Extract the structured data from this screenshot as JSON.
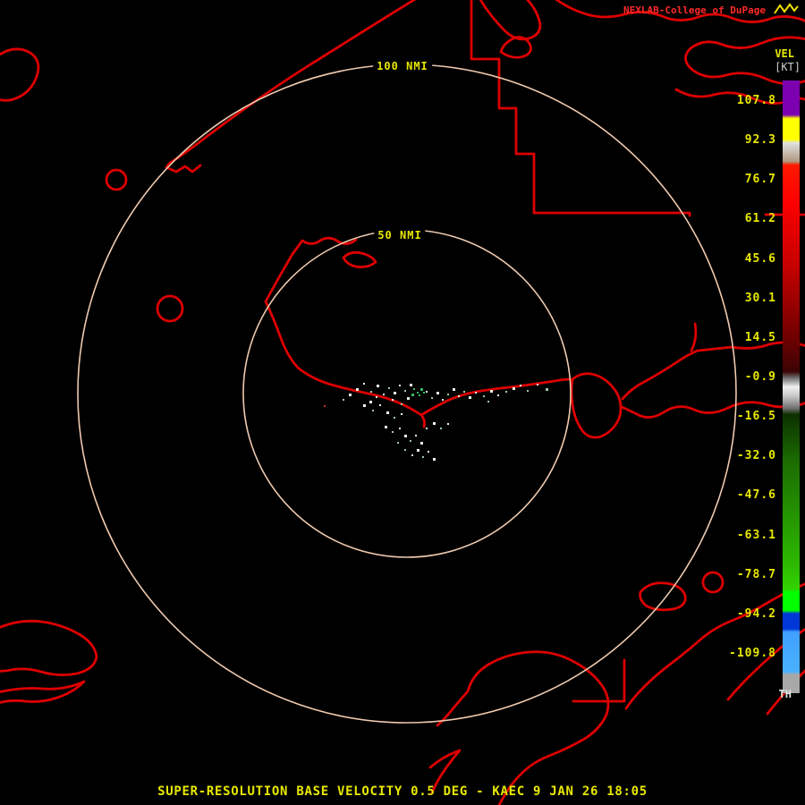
{
  "header": {
    "title": "NEXLAB-College of DuPage",
    "title_color": "#ff2a2a",
    "logo_color": "#f0e000"
  },
  "footer": {
    "caption": "SUPER-RESOLUTION BASE VELOCITY 0.5 DEG - KAEC 9 JAN 26 18:05",
    "caption_color": "#e8e800"
  },
  "map": {
    "background": "#000000",
    "boundary_color": "#dd0000",
    "ring_color": "#eec9ae",
    "label_color": "#e8e800",
    "rings": [
      {
        "label": "100 NMI"
      },
      {
        "label": "50 NMI"
      }
    ],
    "echoes": {
      "colors": {
        "w": "#e8f8e8",
        "p": "#9fc9a8",
        "g": "#2fbf5f",
        "r": "#c03030"
      },
      "dots": [
        [
          398,
          434,
          "w"
        ],
        [
          406,
          428,
          "w"
        ],
        [
          414,
          437,
          "p"
        ],
        [
          421,
          430,
          "w"
        ],
        [
          428,
          440,
          "w"
        ],
        [
          434,
          433,
          "p"
        ],
        [
          440,
          438,
          "w"
        ],
        [
          446,
          430,
          "w"
        ],
        [
          452,
          436,
          "p"
        ],
        [
          458,
          429,
          "w"
        ],
        [
          438,
          446,
          "w"
        ],
        [
          448,
          451,
          "p"
        ],
        [
          455,
          444,
          "w"
        ],
        [
          476,
          437,
          "w"
        ],
        [
          482,
          444,
          "p"
        ],
        [
          488,
          438,
          "w"
        ],
        [
          494,
          446,
          "w"
        ],
        [
          500,
          440,
          "p"
        ],
        [
          506,
          434,
          "w"
        ],
        [
          512,
          442,
          "w"
        ],
        [
          518,
          437,
          "p"
        ],
        [
          524,
          443,
          "w"
        ],
        [
          531,
          438,
          "w"
        ],
        [
          540,
          442,
          "p"
        ],
        [
          548,
          436,
          "w"
        ],
        [
          556,
          441,
          "w"
        ],
        [
          565,
          437,
          "p"
        ],
        [
          573,
          433,
          "w"
        ],
        [
          581,
          430,
          "w"
        ],
        [
          589,
          436,
          "p"
        ],
        [
          406,
          452,
          "w"
        ],
        [
          416,
          458,
          "p"
        ],
        [
          424,
          452,
          "w"
        ],
        [
          432,
          460,
          "w"
        ],
        [
          440,
          466,
          "p"
        ],
        [
          448,
          462,
          "w"
        ],
        [
          430,
          476,
          "w"
        ],
        [
          438,
          482,
          "p"
        ],
        [
          446,
          478,
          "w"
        ],
        [
          452,
          486,
          "w"
        ],
        [
          458,
          492,
          "p"
        ],
        [
          464,
          486,
          "w"
        ],
        [
          470,
          494,
          "w"
        ],
        [
          452,
          502,
          "p"
        ],
        [
          460,
          508,
          "w"
        ],
        [
          466,
          502,
          "w"
        ],
        [
          472,
          510,
          "p"
        ],
        [
          478,
          504,
          "w"
        ],
        [
          484,
          512,
          "w"
        ],
        [
          444,
          494,
          "p"
        ],
        [
          476,
          478,
          "w"
        ],
        [
          484,
          472,
          "w"
        ],
        [
          492,
          478,
          "p"
        ],
        [
          500,
          473,
          "w"
        ],
        [
          390,
          440,
          "w"
        ],
        [
          383,
          446,
          "p"
        ],
        [
          420,
          443,
          "w"
        ],
        [
          413,
          448,
          "w"
        ],
        [
          545,
          448,
          "p"
        ],
        [
          600,
          429,
          "w"
        ],
        [
          610,
          434,
          "p"
        ],
        [
          462,
          434,
          "g"
        ],
        [
          466,
          438,
          "g"
        ],
        [
          470,
          434,
          "g"
        ],
        [
          468,
          441,
          "g"
        ],
        [
          473,
          438,
          "g"
        ],
        [
          460,
          440,
          "g"
        ],
        [
          362,
          453,
          "r"
        ]
      ]
    }
  },
  "colorbar": {
    "unit_line1": "VEL",
    "unit_line2": "[KT]",
    "unit1_color": "#e8e800",
    "unit2_color": "#d0d0d0",
    "bottom_label": "TH",
    "bottom_label_color": "#e0e0e0",
    "tick_color": "#e8e800",
    "ticks": [
      "107.8",
      "92.3",
      "76.7",
      "61.2",
      "45.6",
      "30.1",
      "14.5",
      "-0.9",
      "-16.5",
      "-32.0",
      "-47.6",
      "-63.1",
      "-78.7",
      "-94.2",
      "-109.8"
    ],
    "gradient": [
      {
        "pos": 0,
        "color": "#7d00b0"
      },
      {
        "pos": 5.6,
        "color": "#7d00b0"
      },
      {
        "pos": 6.2,
        "color": "#ffff00"
      },
      {
        "pos": 9.6,
        "color": "#ffff00"
      },
      {
        "pos": 10.2,
        "color": "#e0e0e0"
      },
      {
        "pos": 13.2,
        "color": "#b09880"
      },
      {
        "pos": 13.8,
        "color": "#ff1800"
      },
      {
        "pos": 20,
        "color": "#ff0000"
      },
      {
        "pos": 22,
        "color": "#f00000"
      },
      {
        "pos": 30,
        "color": "#c80000"
      },
      {
        "pos": 36,
        "color": "#9c0000"
      },
      {
        "pos": 42,
        "color": "#700000"
      },
      {
        "pos": 47.5,
        "color": "#3c0404"
      },
      {
        "pos": 48.5,
        "color": "#6a6a6a"
      },
      {
        "pos": 50,
        "color": "#f0f0f0"
      },
      {
        "pos": 51.5,
        "color": "#c8c8c8"
      },
      {
        "pos": 53.5,
        "color": "#707070"
      },
      {
        "pos": 54.5,
        "color": "#0c3000"
      },
      {
        "pos": 62,
        "color": "#1b6b00"
      },
      {
        "pos": 70,
        "color": "#239000"
      },
      {
        "pos": 78,
        "color": "#2cb400"
      },
      {
        "pos": 83,
        "color": "#32d200"
      },
      {
        "pos": 83.5,
        "color": "#00ff00"
      },
      {
        "pos": 86.5,
        "color": "#00ff00"
      },
      {
        "pos": 87,
        "color": "#0038d8"
      },
      {
        "pos": 89.5,
        "color": "#0038d8"
      },
      {
        "pos": 90,
        "color": "#3f9fff"
      },
      {
        "pos": 96.5,
        "color": "#49b2ff"
      },
      {
        "pos": 97,
        "color": "#a8a8a8"
      },
      {
        "pos": 100,
        "color": "#a8a8a8"
      }
    ]
  }
}
